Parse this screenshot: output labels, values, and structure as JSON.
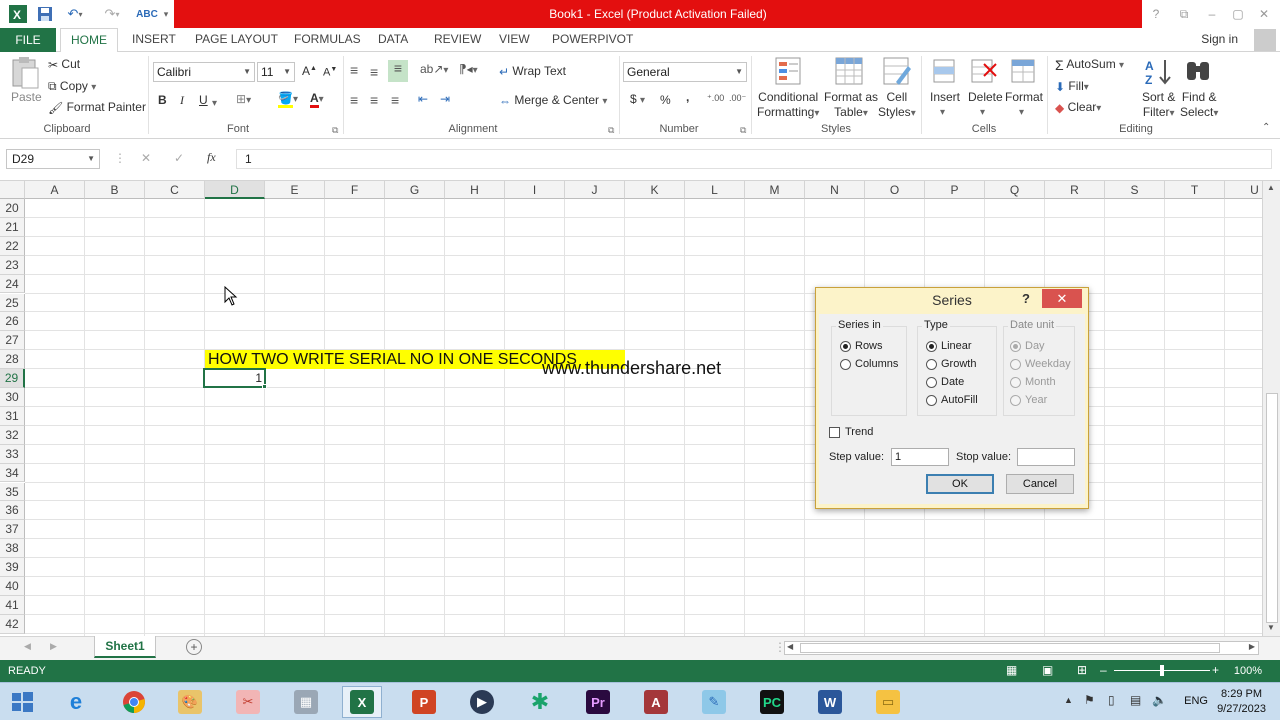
{
  "window": {
    "title": "Book1 - Excel (Product Activation Failed)",
    "help_icon": "?",
    "minimize_icon": "minimize-icon",
    "maximize_icon": "maximize-icon",
    "close_icon": "close-icon"
  },
  "ribbon_tabs": [
    "FILE",
    "HOME",
    "INSERT",
    "PAGE LAYOUT",
    "FORMULAS",
    "DATA",
    "REVIEW",
    "VIEW",
    "POWERPIVOT"
  ],
  "sign_in": "Sign in",
  "ribbon": {
    "clipboard": {
      "label": "Clipboard",
      "paste": "Paste",
      "cut": "Cut",
      "copy": "Copy",
      "format_painter": "Format Painter"
    },
    "font": {
      "label": "Font",
      "font_name": "Calibri",
      "font_size": "11",
      "bold": "B",
      "italic": "I",
      "underline": "U"
    },
    "alignment": {
      "label": "Alignment",
      "wrap_text": "Wrap Text",
      "merge_center": "Merge & Center"
    },
    "number": {
      "label": "Number",
      "format": "General",
      "currency": "$",
      "percent": "%",
      "comma": ","
    },
    "styles": {
      "label": "Styles",
      "conditional_formatting": [
        "Conditional",
        "Formatting"
      ],
      "format_as_table": [
        "Format as",
        "Table"
      ],
      "cell_styles": [
        "Cell",
        "Styles"
      ]
    },
    "cells": {
      "label": "Cells",
      "insert": "Insert",
      "delete": "Delete",
      "format": "Format"
    },
    "editing": {
      "label": "Editing",
      "autosum": "AutoSum",
      "fill": "Fill",
      "clear": "Clear",
      "sort_filter": [
        "Sort &",
        "Filter"
      ],
      "find_select": [
        "Find &",
        "Select"
      ]
    }
  },
  "formula_bar": {
    "name_box": "D29",
    "fx": "fx",
    "value": "1"
  },
  "grid": {
    "columns": [
      "A",
      "B",
      "C",
      "D",
      "E",
      "F",
      "G",
      "H",
      "I",
      "J",
      "K",
      "L",
      "M",
      "N",
      "O",
      "P",
      "Q",
      "R",
      "S",
      "T",
      "U"
    ],
    "selected_column": "D",
    "rows": [
      "20",
      "21",
      "22",
      "23",
      "24",
      "25",
      "26",
      "27",
      "28",
      "29",
      "30",
      "31",
      "32",
      "33",
      "34",
      "35",
      "36",
      "37",
      "38",
      "39",
      "40",
      "41",
      "42"
    ],
    "selected_row": "29",
    "cells": {
      "D28": "HOW TWO WRITE SERIAL NO IN ONE SECONDS",
      "D29": "1"
    },
    "highlight_color": "#ffff00",
    "watermark": "www.thundershare.net"
  },
  "sheet_tabs": [
    "Sheet1"
  ],
  "status": {
    "ready": "READY",
    "zoom": "100%"
  },
  "dialog": {
    "title": "Series",
    "help": "?",
    "series_in": {
      "label": "Series in",
      "options": [
        "Rows",
        "Columns"
      ],
      "selected": "Rows"
    },
    "type": {
      "label": "Type",
      "options": [
        "Linear",
        "Growth",
        "Date",
        "AutoFill"
      ],
      "selected": "Linear"
    },
    "date_unit": {
      "label": "Date unit",
      "options": [
        "Day",
        "Weekday",
        "Month",
        "Year"
      ],
      "selected": "Day",
      "disabled": true
    },
    "trend": {
      "label": "Trend",
      "checked": false
    },
    "step_value": {
      "label": "Step value:",
      "value": "1"
    },
    "stop_value": {
      "label": "Stop value:",
      "value": ""
    },
    "ok": "OK",
    "cancel": "Cancel"
  },
  "taskbar": {
    "apps": [
      "start",
      "internet-explorer",
      "chrome",
      "paint",
      "snipping-tool",
      "calculator",
      "excel",
      "powerpoint",
      "media-player",
      "app-green",
      "premiere",
      "access",
      "notepad",
      "pycharm",
      "word",
      "file-explorer"
    ],
    "active_app": "excel",
    "language": "ENG",
    "time": "8:29 PM",
    "date": "9/27/2023"
  },
  "colors": {
    "excel_green": "#217346",
    "title_red": "#e30f0f",
    "dialog_frame": "#fcf3c9"
  }
}
